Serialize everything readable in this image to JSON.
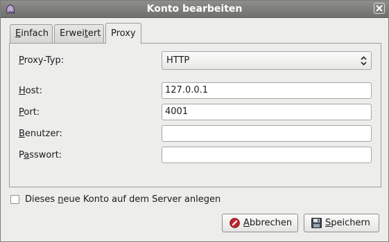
{
  "window": {
    "title": "Konto bearbeiten",
    "app_icon": "pidgin-icon",
    "close_icon": "close-icon"
  },
  "tabs": [
    {
      "label_pre": "",
      "label_u": "E",
      "label_post": "infach",
      "active": false
    },
    {
      "label_pre": "Erwei",
      "label_u": "t",
      "label_post": "ert",
      "active": false
    },
    {
      "label_pre": "Proxy",
      "label_u": "",
      "label_post": "",
      "active": true
    }
  ],
  "proxy": {
    "type_label": {
      "pre": "",
      "u": "P",
      "post": "roxy-Typ:"
    },
    "type_value": "HTTP",
    "host_label": {
      "pre": "",
      "u": "H",
      "post": "ost:"
    },
    "host_value": "127.0.0.1",
    "port_label": {
      "pre": "",
      "u": "P",
      "post": "ort:"
    },
    "port_value": "4001",
    "user_label": {
      "pre": "",
      "u": "B",
      "post": "enutzer:"
    },
    "user_value": "",
    "password_label": {
      "pre": "P",
      "u": "a",
      "post": "sswort:"
    },
    "password_value": ""
  },
  "checkbox": {
    "label_pre": "Dieses ",
    "label_u": "n",
    "label_post": "eue Konto auf dem Server anlegen",
    "checked": false
  },
  "buttons": {
    "cancel": {
      "pre": "",
      "u": "A",
      "post": "bbrechen",
      "icon": "cancel-icon"
    },
    "save": {
      "pre": "",
      "u": "S",
      "post": "peichern",
      "icon": "floppy-disk-icon"
    }
  },
  "colors": {
    "titlebar": "#7f7f7d",
    "window_bg": "#ededec",
    "cancel_icon_red": "#c0262b"
  }
}
